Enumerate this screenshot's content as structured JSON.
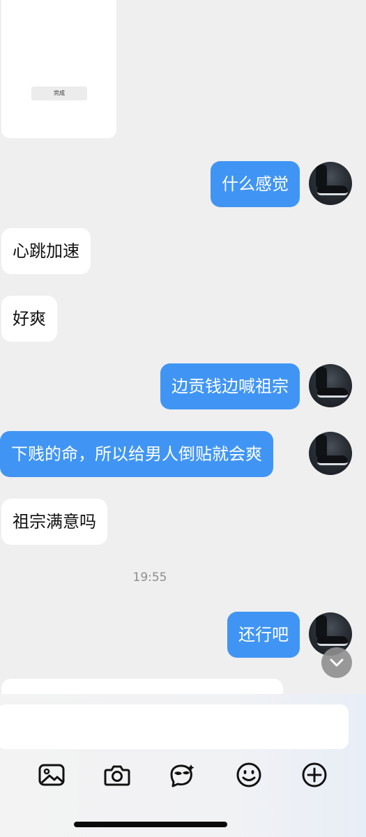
{
  "card": {
    "button_label": "完成"
  },
  "messages": [
    {
      "id": "m1",
      "direction": "out",
      "text": "什么感觉"
    },
    {
      "id": "m2",
      "direction": "in",
      "text": "心跳加速"
    },
    {
      "id": "m3",
      "direction": "in",
      "text": "好爽"
    },
    {
      "id": "m4",
      "direction": "out",
      "text": "边贡钱边喊祖宗"
    },
    {
      "id": "m5",
      "direction": "out",
      "text": "下贱的命，所以给男人倒贴就会爽"
    },
    {
      "id": "m6",
      "direction": "in",
      "text": "祖宗满意吗"
    },
    {
      "id": "m7",
      "direction": "out",
      "text": "还行吧"
    }
  ],
  "timestamp": "19:55",
  "input": {
    "placeholder": ""
  },
  "toolbar": {
    "icons": [
      "image-icon",
      "camera-icon",
      "sticker-face-icon",
      "emoji-icon",
      "plus-icon"
    ]
  },
  "colors": {
    "outgoing_bubble": "#4095f4",
    "incoming_bubble": "#ffffff",
    "background": "#efefef"
  }
}
